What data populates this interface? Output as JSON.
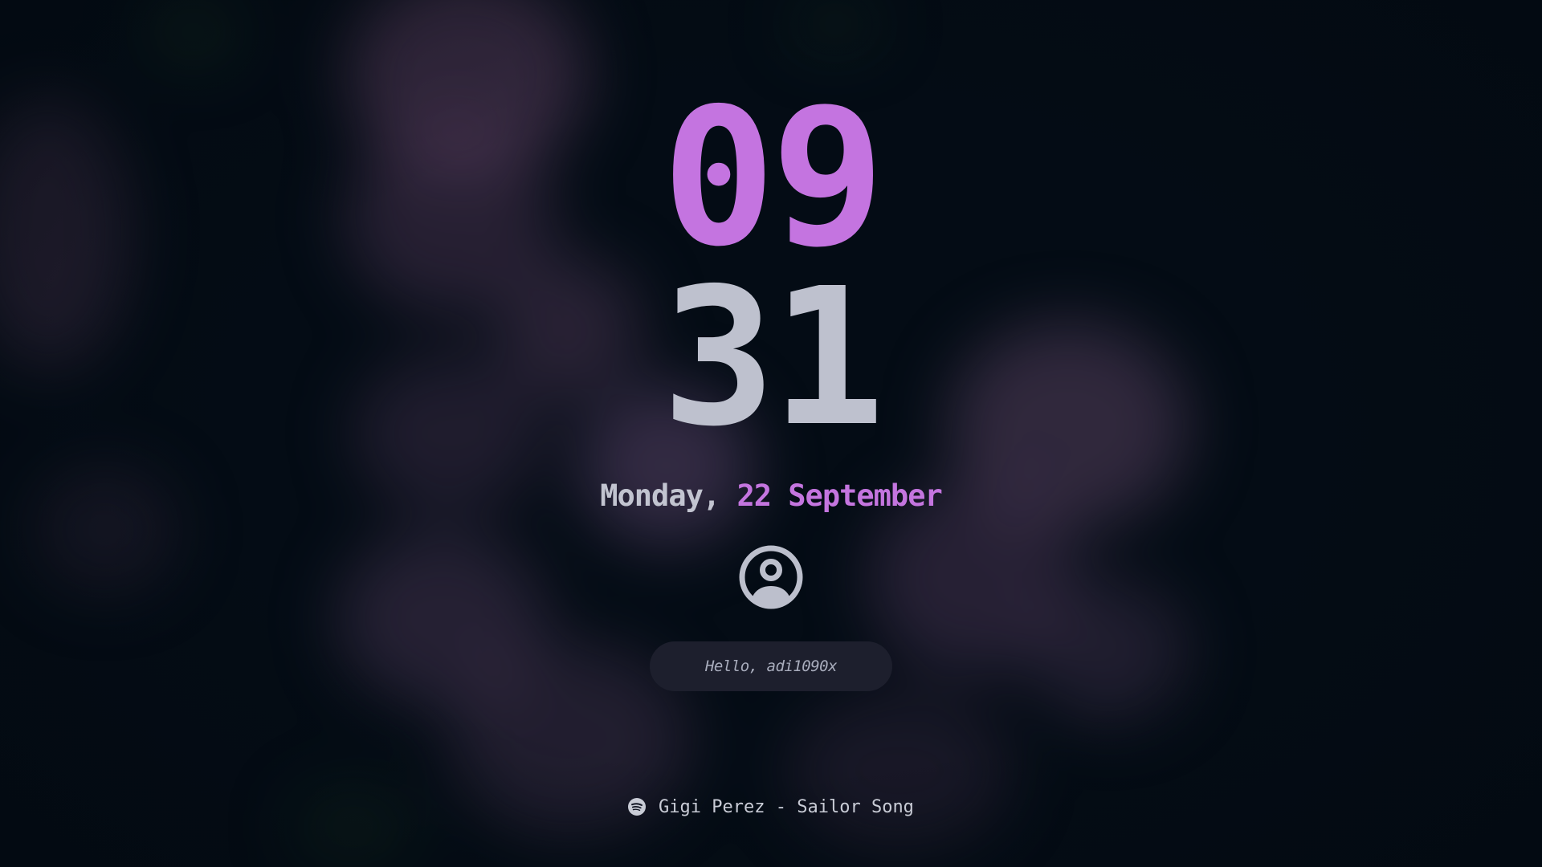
{
  "clock": {
    "hours": "09",
    "minutes": "31"
  },
  "date": {
    "weekday": "Monday,",
    "day_month": "22 September"
  },
  "user": {
    "avatar_icon": "user-circle-icon",
    "greeting_placeholder": "Hello, adi1090x"
  },
  "media": {
    "icon": "spotify-icon",
    "track": "Gigi Perez - Sailor Song"
  },
  "colors": {
    "accent": "#c474e0",
    "foreground": "#bec1ce",
    "background": "#040c15",
    "input_background": "#1d1f2d"
  }
}
